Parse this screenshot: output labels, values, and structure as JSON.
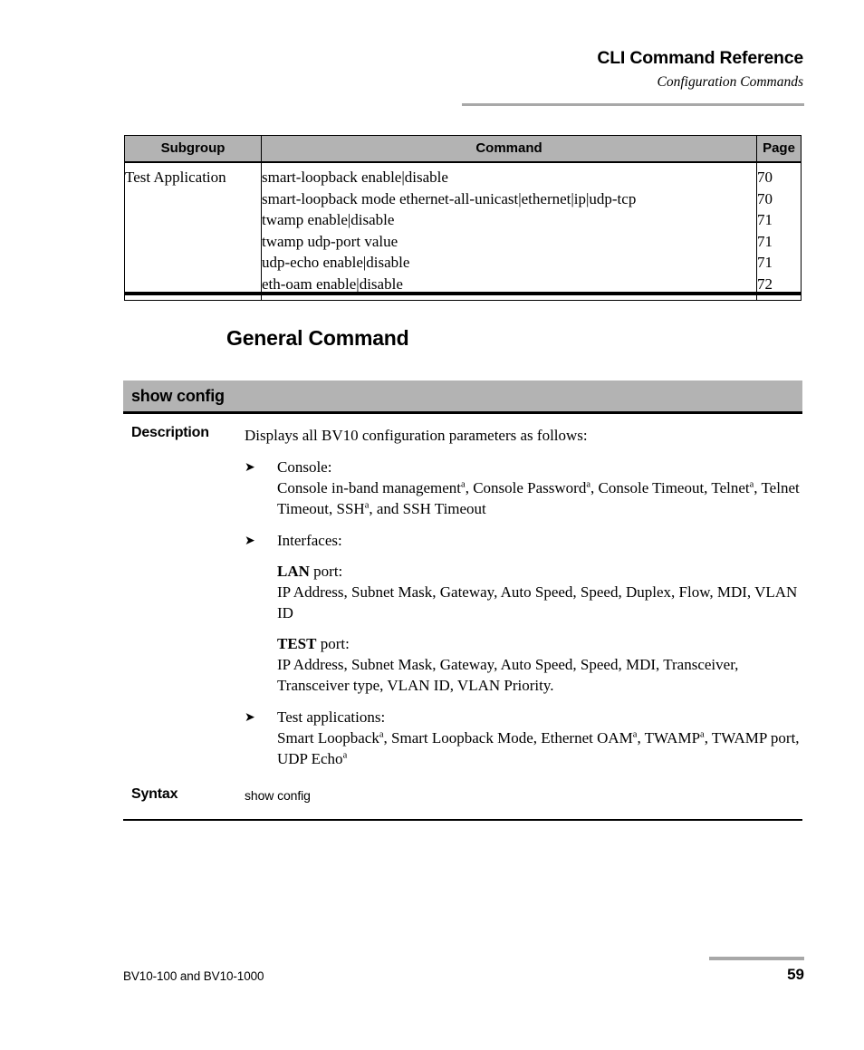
{
  "header": {
    "title": "CLI Command Reference",
    "subtitle": "Configuration Commands"
  },
  "summary_table": {
    "columns": [
      "Subgroup",
      "Command",
      "Page"
    ],
    "rows": [
      {
        "subgroup": "Test Application",
        "commands": [
          "smart-loopback enable|disable",
          "smart-loopback mode ethernet-all-unicast|ethernet|ip|udp-tcp",
          "twamp enable|disable",
          "twamp udp-port value",
          "udp-echo enable|disable",
          "eth-oam enable|disable"
        ],
        "pages": [
          "70",
          "70",
          "71",
          "71",
          "71",
          "72"
        ]
      }
    ]
  },
  "section": {
    "heading": "General Command"
  },
  "command": {
    "title": "show config",
    "description_label": "Description",
    "description_intro": "Displays all BV10 configuration parameters as follows:",
    "bullets": [
      {
        "heading": "Console:",
        "detail": "Console in-band managementᵃ, Console Passwordᵃ, Console Timeout, Telnetᵃ, Telnet Timeout, SSHᵃ, and SSH Timeout"
      },
      {
        "heading": "Interfaces:",
        "sub_sections": [
          {
            "lead": "LAN",
            "lead_suffix": " port:",
            "detail": "IP Address, Subnet Mask, Gateway, Auto Speed, Speed, Duplex, Flow, MDI, VLAN ID"
          },
          {
            "lead": "TEST",
            "lead_suffix": " port:",
            "detail": "IP Address, Subnet Mask, Gateway, Auto Speed, Speed, MDI, Transceiver, Transceiver type, VLAN ID, VLAN Priority."
          }
        ]
      },
      {
        "heading": "Test applications:",
        "detail": "Smart Loopbackᵃ, Smart Loopback Mode, Ethernet OAMᵃ, TWAMPᵃ, TWAMP port, UDP Echoᵃ"
      }
    ],
    "syntax_label": "Syntax",
    "syntax_text": "show config"
  },
  "footer": {
    "left": "BV10-100 and BV10-1000",
    "page": "59"
  },
  "colors": {
    "header_gray": "#b3b3b3",
    "rule_gray": "#a8a8a8",
    "text": "#000000"
  },
  "icons": {
    "bullet": "arrow-bullet-icon"
  }
}
